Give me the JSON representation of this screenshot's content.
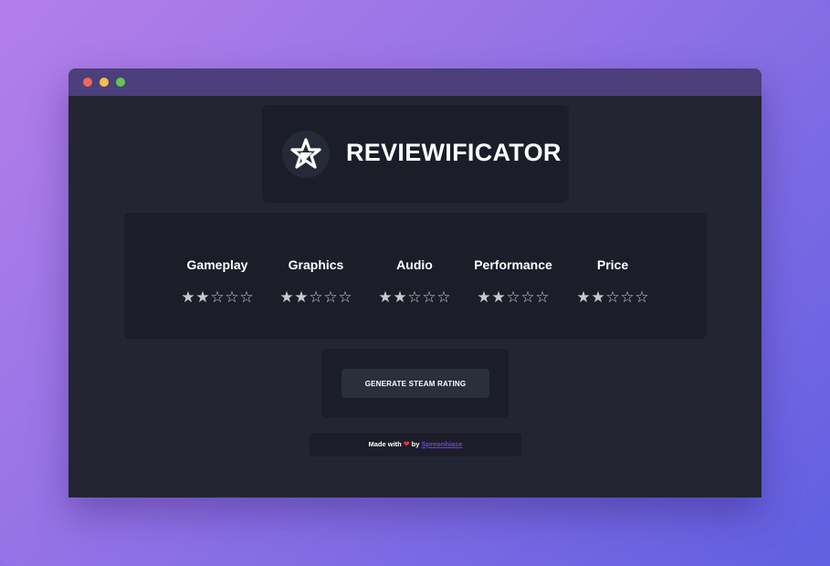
{
  "window": {
    "controls": [
      "close",
      "minimize",
      "maximize"
    ]
  },
  "header": {
    "title": "REVIEWIFICATOR",
    "logo_icon": "star-logo-icon"
  },
  "ratings": {
    "max_stars": 5,
    "categories": [
      {
        "label": "Gameplay",
        "value": 2
      },
      {
        "label": "Graphics",
        "value": 2
      },
      {
        "label": "Audio",
        "value": 2
      },
      {
        "label": "Performance",
        "value": 2
      },
      {
        "label": "Price",
        "value": 2
      }
    ],
    "filled_glyph": "★",
    "empty_glyph": "☆"
  },
  "actions": {
    "generate_label": "GENERATE STEAM RATING"
  },
  "footer": {
    "made_with": "Made with",
    "heart": "❤",
    "by": "by",
    "author": "Spreonhiase"
  },
  "colors": {
    "window_bg": "#232632",
    "card_bg": "#1b1e29",
    "titlebar": "#4c3f7c",
    "heart": "#e53535",
    "link": "#7b3fd6"
  }
}
